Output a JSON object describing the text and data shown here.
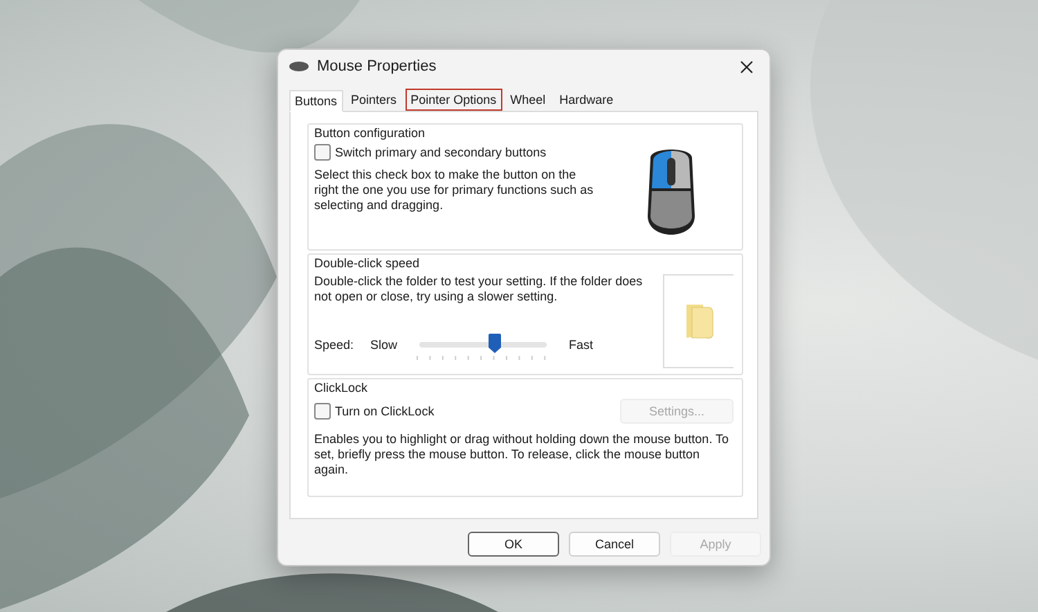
{
  "window": {
    "title": "Mouse Properties"
  },
  "tabs": [
    {
      "label": "Buttons",
      "selected": true,
      "highlighted": false
    },
    {
      "label": "Pointers",
      "selected": false,
      "highlighted": false
    },
    {
      "label": "Pointer Options",
      "selected": false,
      "highlighted": true
    },
    {
      "label": "Wheel",
      "selected": false,
      "highlighted": false
    },
    {
      "label": "Hardware",
      "selected": false,
      "highlighted": false
    }
  ],
  "button_configuration": {
    "title": "Button configuration",
    "checkbox": {
      "label": "Switch primary and secondary buttons",
      "checked": false
    },
    "description": "Select this check box to make the button on the right the one you use for primary functions such as selecting and dragging."
  },
  "double_click_speed": {
    "title": "Double-click speed",
    "description": "Double-click the folder to test your setting. If the folder does not open or close, try using a slower setting.",
    "speed_label": "Speed:",
    "slow_label": "Slow",
    "fast_label": "Fast",
    "slider": {
      "level": 0.59
    }
  },
  "clicklock": {
    "title": "ClickLock",
    "checkbox": {
      "label": "Turn on ClickLock",
      "checked": false
    },
    "settings_button": {
      "label": "Settings...",
      "disabled": true
    },
    "description": "Enables you to highlight or drag without holding down the mouse button. To set, briefly press the mouse button. To release, click the mouse button again."
  },
  "buttons": [
    {
      "label": "OK",
      "disabled": false,
      "default": true
    },
    {
      "label": "Cancel",
      "disabled": false,
      "default": false
    },
    {
      "label": "Apply",
      "disabled": true,
      "default": false
    }
  ]
}
